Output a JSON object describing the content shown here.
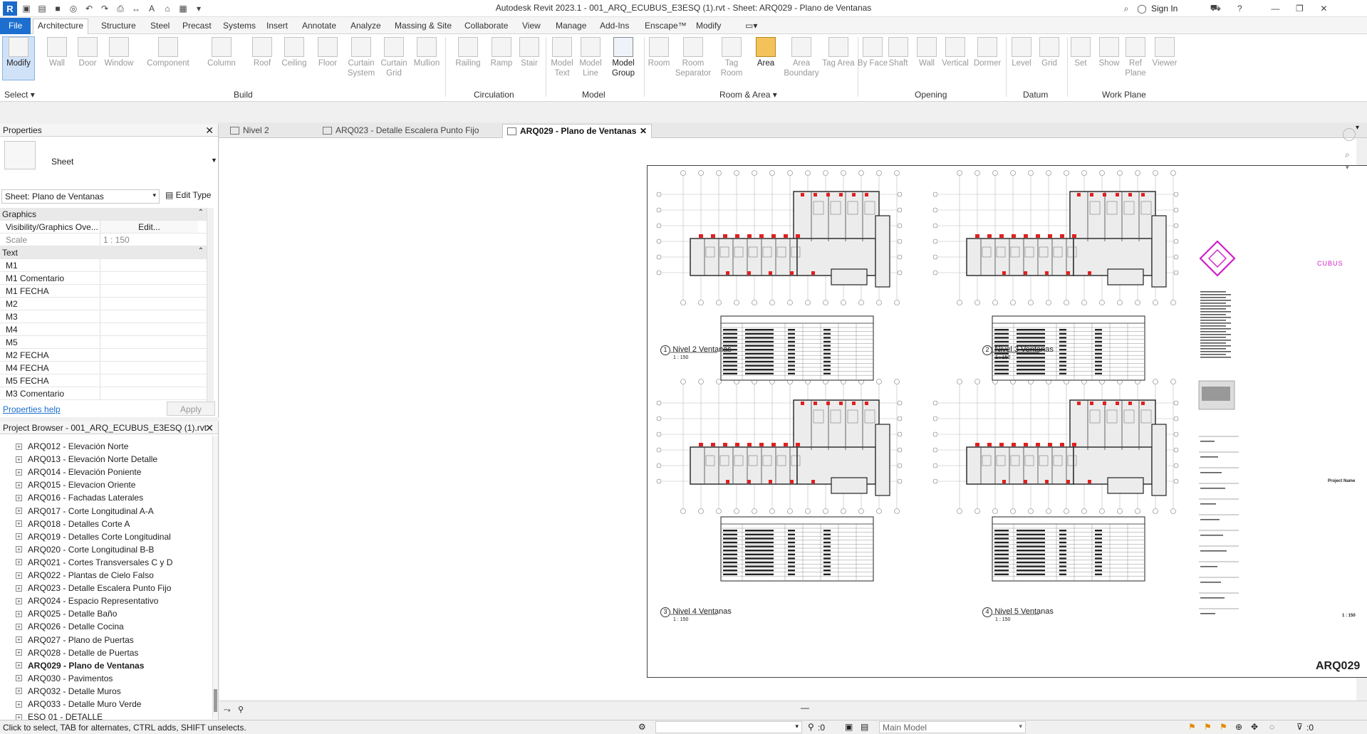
{
  "title_bar": {
    "title": "Autodesk Revit 2023.1 - 001_ARQ_ECUBUS_E3ESQ (1).rvt - Sheet: ARQ029 - Plano de Ventanas",
    "sign_in": "Sign In",
    "app_logo": "R"
  },
  "ribbon_tabs": [
    "File",
    "Architecture",
    "Structure",
    "Steel",
    "Precast",
    "Systems",
    "Insert",
    "Annotate",
    "Analyze",
    "Massing & Site",
    "Collaborate",
    "View",
    "Manage",
    "Add-Ins",
    "Enscape™",
    "Modify"
  ],
  "ribbon": {
    "tools": [
      "Modify",
      "Wall",
      "Door",
      "Window",
      "Component",
      "Column",
      "Roof",
      "Ceiling",
      "Floor",
      "Curtain System",
      "Curtain Grid",
      "Mullion",
      "Railing",
      "Ramp",
      "Stair",
      "Model Text",
      "Model Line",
      "Model Group",
      "Room",
      "Room Separator",
      "Tag Room",
      "Area",
      "Area Boundary",
      "Tag Area",
      "By Face",
      "Shaft",
      "Wall",
      "Vertical",
      "Dormer",
      "Level",
      "Grid",
      "Set",
      "Show",
      "Ref Plane",
      "Viewer"
    ],
    "panels": [
      "Select",
      "Build",
      "Circulation",
      "Model",
      "Room & Area",
      "Opening",
      "Datum",
      "Work Plane"
    ]
  },
  "properties": {
    "header": "Properties",
    "type_name": "Sheet",
    "selector": "Sheet: Plano de Ventanas",
    "edit_type": "Edit Type",
    "graphics_section": "Graphics",
    "rows_graphics": [
      {
        "k": "Visibility/Graphics Ove...",
        "v": "Edit..."
      },
      {
        "k": "Scale",
        "v": "1 : 150"
      }
    ],
    "text_section": "Text",
    "rows_text": [
      "M1",
      "M1 Comentario",
      "M1 FECHA",
      "M2",
      "M3",
      "M4",
      "M5",
      "M2 FECHA",
      "M4 FECHA",
      "M5 FECHA",
      "M3 Comentario"
    ],
    "help": "Properties help",
    "apply": "Apply"
  },
  "project_browser": {
    "header": "Project Browser - 001_ARQ_ECUBUS_E3ESQ (1).rvt",
    "items": [
      "ARQ012 - Elevación Norte",
      "ARQ013 - Elevación Norte Detalle",
      "ARQ014 - Elevación Poniente",
      "ARQ015 - Elevacion Oriente",
      "ARQ016 - Fachadas Laterales",
      "ARQ017 - Corte Longitudinal A-A",
      "ARQ018 - Detalles Corte A",
      "ARQ019 - Detalles Corte Longitudinal",
      "ARQ020 - Corte Longitudinal B-B",
      "ARQ021 - Cortes Transversales C y D",
      "ARQ022 - Plantas de Cielo Falso",
      "ARQ023 - Detalle Escalera Punto Fijo",
      "ARQ024 - Espacio Representativo",
      "ARQ025 - Detalle Baño",
      "ARQ026 - Detalle Cocina",
      "ARQ027 - Plano de Puertas",
      "ARQ028 - Detalle de Puertas",
      "ARQ029 - Plano de Ventanas",
      "ARQ030 - Pavimentos",
      "ARQ032 - Detalle Muros",
      "ARQ033 - Detalle Muro Verde",
      "ESQ 01 - DETALLE"
    ],
    "selected_index": 17
  },
  "view_tabs": [
    "Nivel 2",
    "ARQ023 - Detalle Escalera Punto Fijo",
    "ARQ029 - Plano de Ventanas"
  ],
  "sheet": {
    "views": [
      {
        "num": "1",
        "name": "Nivel 2 Ventanas",
        "scale": "1 : 150"
      },
      {
        "num": "2",
        "name": "Nivel 3 Ventanas",
        "scale": "1 : 150"
      },
      {
        "num": "3",
        "name": "Nivel 4 Ventanas",
        "scale": "1 : 150"
      },
      {
        "num": "4",
        "name": "Nivel 5 Ventanas",
        "scale": "1 : 150"
      }
    ],
    "logo_text": "CUBUS",
    "project_name": "Project Name",
    "sheet_number": "ARQ029",
    "scale_block": "1 : 150"
  },
  "status_bar": {
    "message": "Click to select, TAB for alternates, CTRL adds, SHIFT unselects.",
    "count": ":0",
    "model": "Main Model",
    "filter": ":0"
  },
  "colors": {
    "file_tab": "#1d6fcf",
    "accent_red": "#e02020",
    "logo_magenta": "#d21ec8"
  }
}
